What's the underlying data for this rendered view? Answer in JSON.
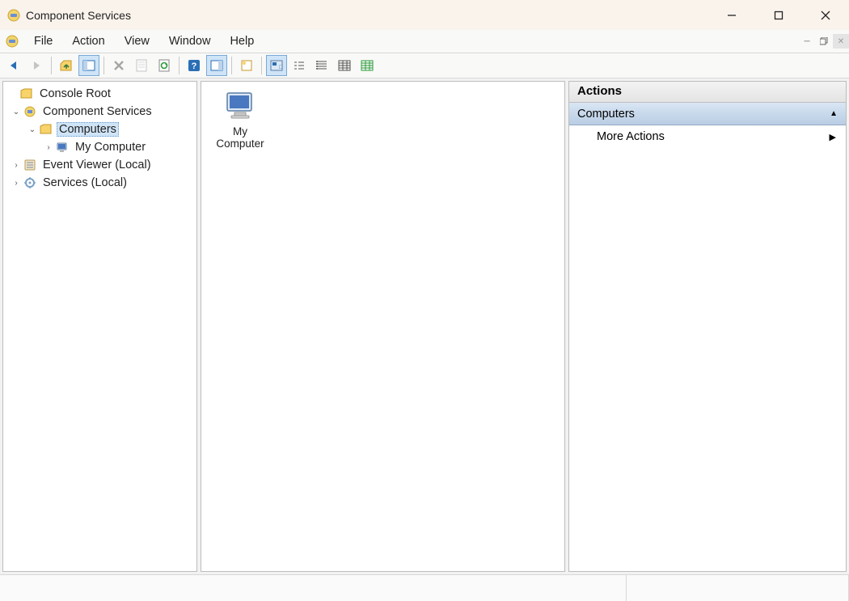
{
  "window": {
    "title": "Component Services"
  },
  "menu": {
    "file": "File",
    "action": "Action",
    "view": "View",
    "window": "Window",
    "help": "Help"
  },
  "tree": {
    "root": "Console Root",
    "comp_services": "Component Services",
    "computers": "Computers",
    "my_computer": "My Computer",
    "event_viewer": "Event Viewer (Local)",
    "services": "Services (Local)"
  },
  "content": {
    "my_computer": "My Computer"
  },
  "actions": {
    "header": "Actions",
    "group": "Computers",
    "more": "More Actions"
  }
}
